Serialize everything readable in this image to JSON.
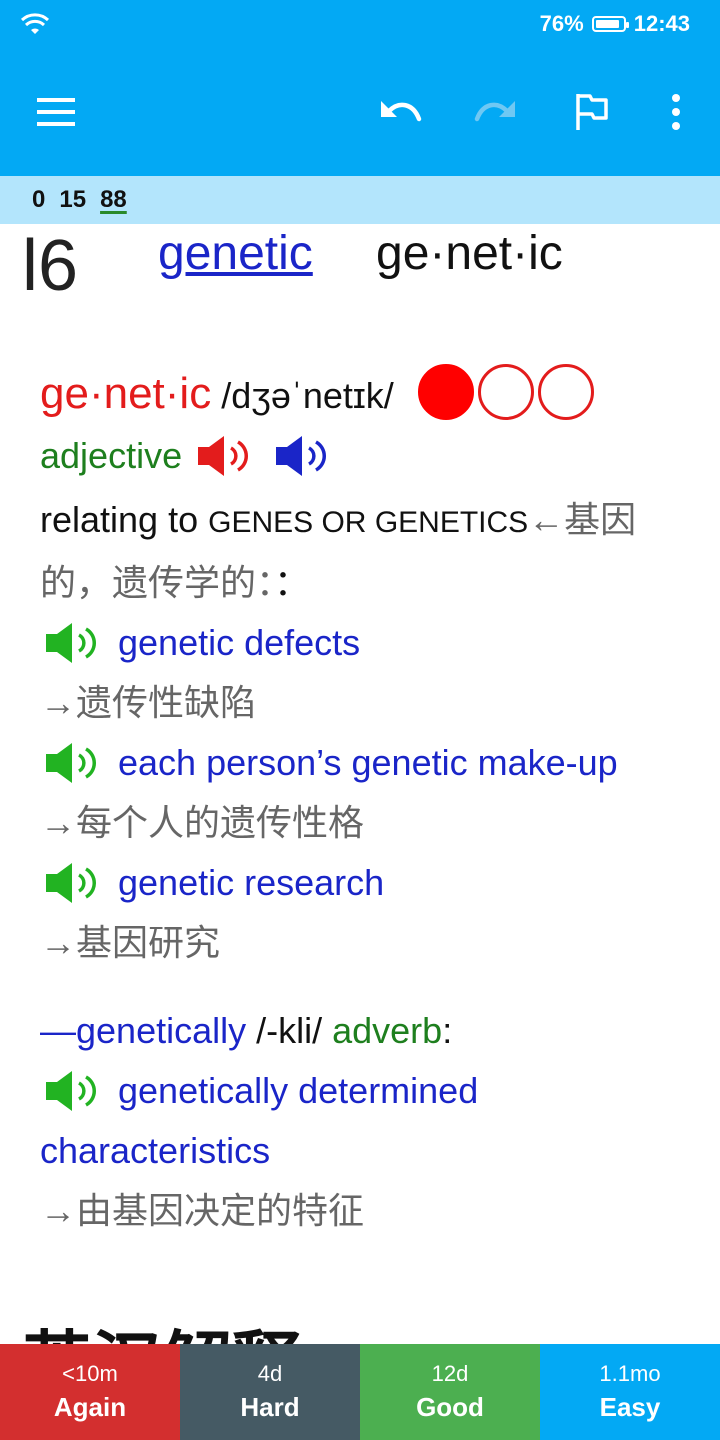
{
  "status": {
    "battery": "76%",
    "battery_level": 0.76,
    "time": "12:43"
  },
  "counts": {
    "new": "0",
    "learning": "15",
    "review": "88"
  },
  "card_header": {
    "number": "l6",
    "link_word": "genetic",
    "syllabified": "ge·net·ic"
  },
  "entry": {
    "headword": "ge·net·ic",
    "pronunciation": "/dʒəˈnetɪk/",
    "frequency_filled": 1,
    "pos": "adjective",
    "definition_prefix": "relating to ",
    "definition_sc1": "GENES",
    "definition_or": " OR ",
    "definition_sc2": "GENETICS",
    "definition_cn": "←基因的，遗传学的：",
    "definition_colon": "：",
    "examples": [
      {
        "en": "genetic defects",
        "cn": "→遗传性缺陷"
      },
      {
        "en": "each person’s genetic make-up",
        "cn": "→每个人的遗传性格"
      },
      {
        "en": "genetic research",
        "cn": "→基因研究"
      }
    ],
    "derived": {
      "word": "—genetically",
      "pron": " /-kli/ ",
      "pos": "adverb",
      "colon": ":",
      "example_en": "genetically determined characteristics",
      "example_cn": "→由基因决定的特征"
    }
  },
  "cut_off_text": "英汉解释",
  "answer_buttons": [
    {
      "time": "<10m",
      "label": "Again",
      "color": "#D32F2F"
    },
    {
      "time": "4d",
      "label": "Hard",
      "color": "#455A64"
    },
    {
      "time": "12d",
      "label": "Good",
      "color": "#4CAF50"
    },
    {
      "time": "1.1mo",
      "label": "Easy",
      "color": "#03A9F4"
    }
  ]
}
